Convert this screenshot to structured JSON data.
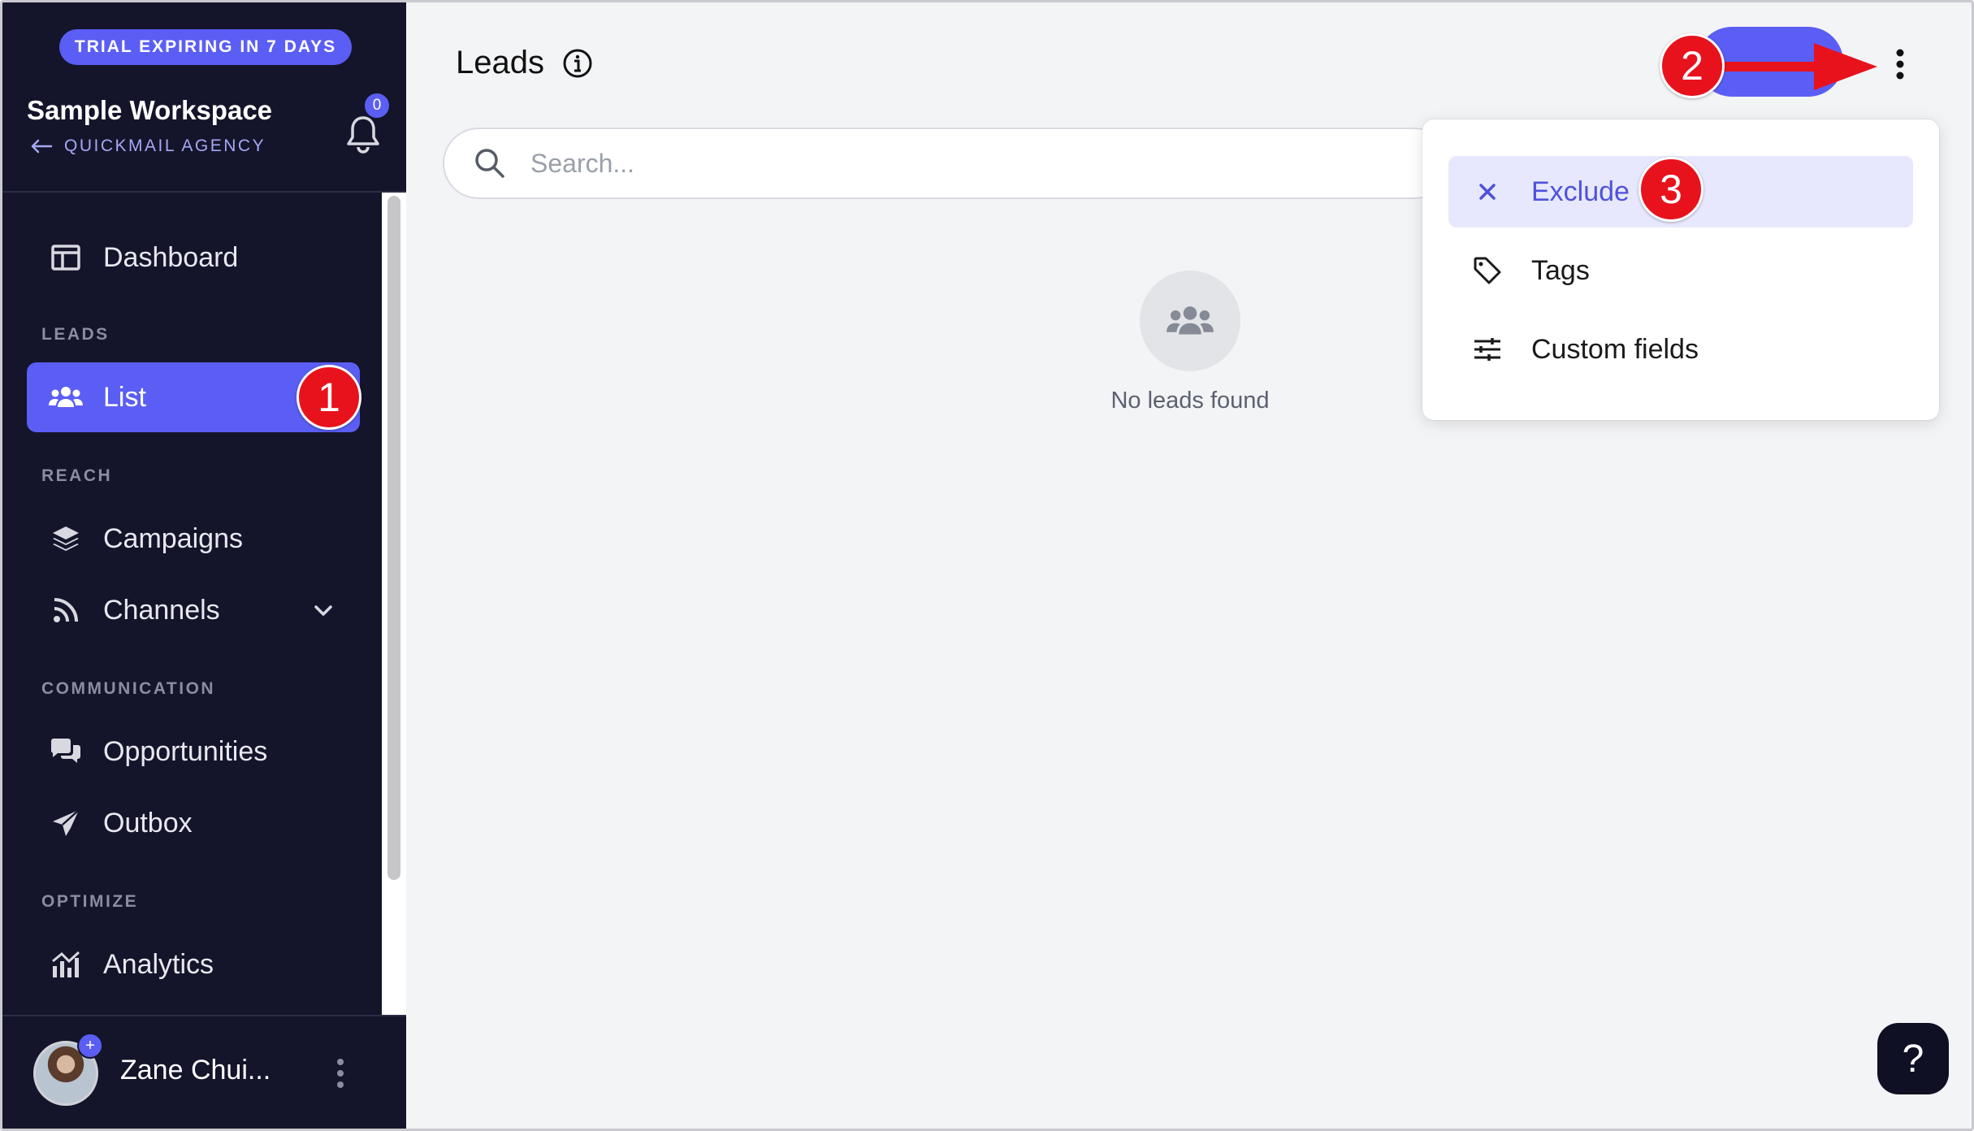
{
  "sidebar": {
    "trial_badge": "TRIAL EXPIRING IN 7 DAYS",
    "workspace_name": "Sample Workspace",
    "agency_link": "QUICKMAIL AGENCY",
    "notification_count": "0",
    "sections": {
      "leads": "LEADS",
      "reach": "REACH",
      "communication": "COMMUNICATION",
      "optimize": "OPTIMIZE"
    },
    "items": {
      "dashboard": "Dashboard",
      "list": "List",
      "campaigns": "Campaigns",
      "channels": "Channels",
      "opportunities": "Opportunities",
      "outbox": "Outbox",
      "analytics": "Analytics"
    },
    "user_name": "Zane Chui...",
    "user_badge": "+"
  },
  "main": {
    "title": "Leads",
    "search_placeholder": "Search...",
    "empty_text": "No leads found"
  },
  "dropdown": {
    "items": [
      "Exclude",
      "Tags",
      "Custom fields"
    ]
  },
  "annotations": {
    "markers": [
      "1",
      "2",
      "3"
    ]
  },
  "help_label": "?",
  "colors": {
    "sidebar_bg": "#14152b",
    "accent": "#5b5ef4",
    "marker_red": "#e8121c",
    "highlight_bg": "#e7e8fd"
  }
}
